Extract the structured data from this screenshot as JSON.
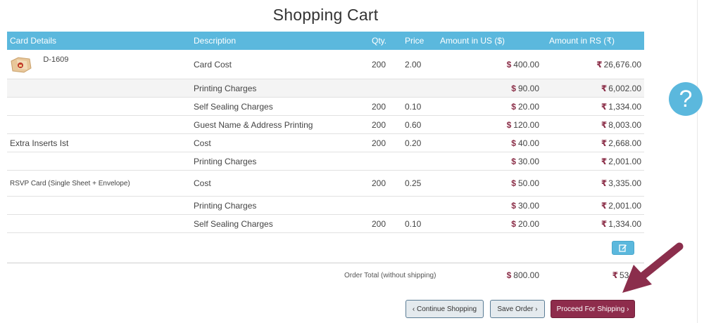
{
  "page": {
    "title": "Shopping Cart"
  },
  "table": {
    "headers": [
      "Card Details",
      "Description",
      "Qty.",
      "Price",
      "Amount in US ($)",
      "Amount in RS (₹)"
    ],
    "rows": [
      {
        "details": "D-1609",
        "desc": "Card Cost",
        "qty": "200",
        "price": "2.00",
        "us": "400.00",
        "rs": "26,676.00"
      },
      {
        "details": "",
        "desc": "Printing Charges",
        "qty": "",
        "price": "",
        "us": "90.00",
        "rs": "6,002.00"
      },
      {
        "details": "",
        "desc": "Self Sealing Charges",
        "qty": "200",
        "price": "0.10",
        "us": "20.00",
        "rs": "1,334.00"
      },
      {
        "details": "",
        "desc": "Guest Name & Address Printing",
        "qty": "200",
        "price": "0.60",
        "us": "120.00",
        "rs": "8,003.00"
      },
      {
        "details": "Extra Inserts Ist",
        "desc": "Cost",
        "qty": "200",
        "price": "0.20",
        "us": "40.00",
        "rs": "2,668.00"
      },
      {
        "details": "",
        "desc": "Printing Charges",
        "qty": "",
        "price": "",
        "us": "30.00",
        "rs": "2,001.00"
      },
      {
        "details": "RSVP Card (Single Sheet + Envelope)",
        "desc": "Cost",
        "qty": "200",
        "price": "0.25",
        "us": "50.00",
        "rs": "3,335.00"
      },
      {
        "details": "",
        "desc": "Printing Charges",
        "qty": "",
        "price": "",
        "us": "30.00",
        "rs": "2,001.00"
      },
      {
        "details": "",
        "desc": "Self Sealing Charges",
        "qty": "200",
        "price": "0.10",
        "us": "20.00",
        "rs": "1,334.00"
      }
    ]
  },
  "currency": {
    "us_symbol": "$",
    "rs_symbol": "₹"
  },
  "total": {
    "label": "Order Total (without shipping)",
    "us": "800.00",
    "rs": "53,35"
  },
  "buttons": {
    "continue": "‹ Continue Shopping",
    "save": "Save Order ›",
    "ship": "Proceed For Shipping ›"
  },
  "help": {
    "glyph": "?"
  },
  "icons": {
    "edit": "edit-icon",
    "help": "help-icon",
    "thumbnail": "card-thumbnail",
    "arrow": "pointer-arrow"
  },
  "colors": {
    "header": "#5bb8dd",
    "accent": "#8e2c4c",
    "arrow": "#8b2e4c"
  }
}
